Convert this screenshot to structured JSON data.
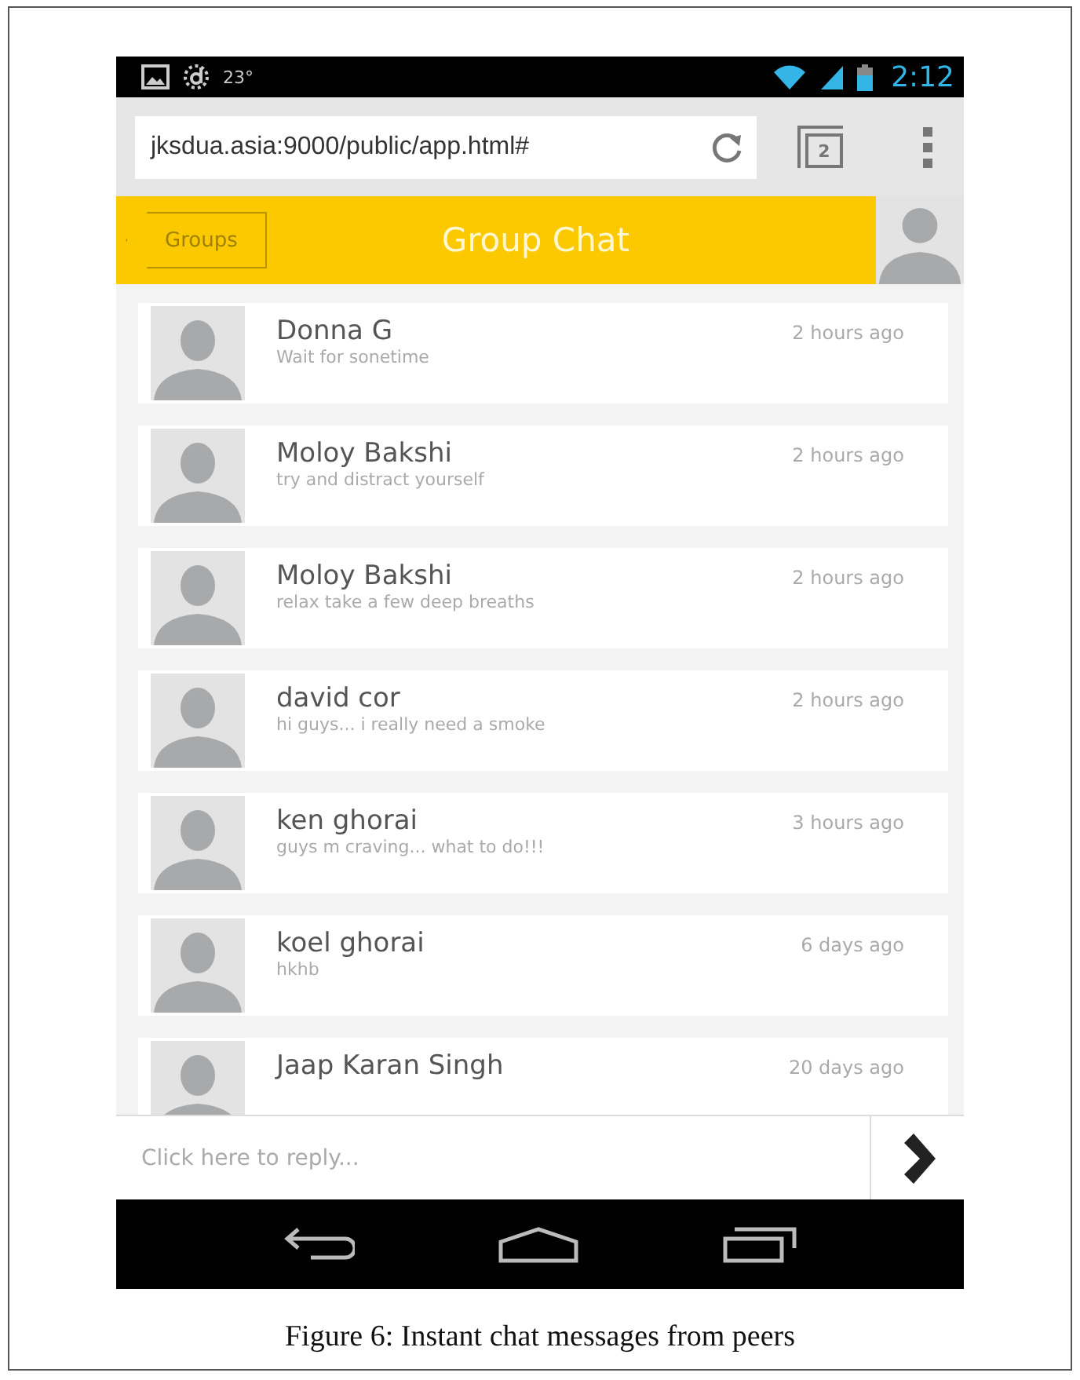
{
  "status_bar": {
    "temperature": "23°",
    "time": "2:12"
  },
  "browser": {
    "url": "jksdua.asia:9000/public/app.html#",
    "tab_count": "2"
  },
  "header": {
    "back": "Groups",
    "title": "Group Chat"
  },
  "messages": [
    {
      "name": "Donna G",
      "text": "Wait for sonetime",
      "time": "2 hours ago"
    },
    {
      "name": "Moloy Bakshi",
      "text": "try and distract yourself",
      "time": "2 hours ago"
    },
    {
      "name": "Moloy Bakshi",
      "text": "relax take a few deep breaths",
      "time": "2 hours ago"
    },
    {
      "name": "david cor",
      "text": "hi guys... i really need a smoke",
      "time": "2 hours ago"
    },
    {
      "name": "ken ghorai",
      "text": "guys m craving... what to do!!!",
      "time": "3 hours ago"
    },
    {
      "name": "koel ghorai",
      "text": "hkhb",
      "time": "6 days ago"
    },
    {
      "name": "Jaap Karan Singh",
      "time": "20 days ago"
    }
  ],
  "reply": {
    "placeholder": "Click here to reply..."
  },
  "caption": "Figure 6: Instant chat messages from peers"
}
